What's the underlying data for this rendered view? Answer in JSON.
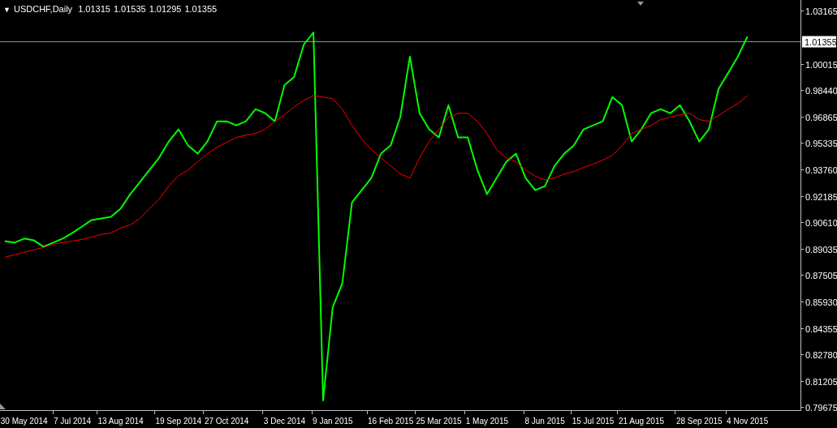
{
  "current_price": {
    "label": "1.01355"
  },
  "header": {
    "menu_glyph": "▼",
    "title": "USDCHF,Daily",
    "ohlc": [
      "1.01315",
      "1.01535",
      "1.01295",
      "1.01355"
    ]
  },
  "chart_data": {
    "type": "line",
    "categories": [
      null,
      null,
      "30 May 2014",
      null,
      null,
      null,
      null,
      "7 Jul 2014",
      null,
      null,
      null,
      null,
      "13 Aug 2014",
      null,
      null,
      null,
      null,
      null,
      "19 Sep 2014",
      null,
      null,
      null,
      null,
      "27 Oct 2014",
      null,
      null,
      null,
      null,
      null,
      "3 Dec 2014",
      null,
      null,
      null,
      null,
      "9 Jan 2015",
      null,
      null,
      null,
      null,
      null,
      "16 Feb 2015",
      null,
      null,
      null,
      null,
      "25 Mar 2015",
      null,
      null,
      null,
      null,
      "1 May 2015",
      null,
      null,
      null,
      null,
      null,
      "8 Jun 2015",
      null,
      null,
      null,
      null,
      "15 Jul 2015",
      null,
      null,
      null,
      null,
      "21 Aug 2015",
      null,
      null,
      null,
      null,
      null,
      "28 Sep 2015",
      null,
      null,
      null,
      null,
      "4 Nov 2015",
      null,
      null,
      null,
      null,
      null
    ],
    "series": [
      {
        "color": "#00ff00",
        "values": [
          0.895,
          0.8941,
          0.8965,
          0.8955,
          0.8917,
          0.8941,
          0.8965,
          0.8998,
          0.9036,
          0.9075,
          0.9084,
          0.9094,
          0.9142,
          0.9228,
          0.93,
          0.9372,
          0.9444,
          0.954,
          0.9612,
          0.9516,
          0.9468,
          0.954,
          0.966,
          0.966,
          0.9636,
          0.966,
          0.9732,
          0.9708,
          0.966,
          0.9875,
          0.9923,
          1.0115,
          1.0187,
          0.8006,
          0.8557,
          0.8701,
          0.918,
          0.9252,
          0.9324,
          0.9468,
          0.9516,
          0.9684,
          1.0043,
          0.9708,
          0.9612,
          0.9564,
          0.9756,
          0.9564,
          0.9564,
          0.9372,
          0.9228,
          0.9324,
          0.942,
          0.9468,
          0.9324,
          0.9252,
          0.9276,
          0.9396,
          0.9468,
          0.9516,
          0.9612,
          0.9636,
          0.966,
          0.9804,
          0.9756,
          0.954,
          0.9612,
          0.9708,
          0.9732,
          0.9708,
          0.9756,
          0.966,
          0.954,
          0.9612,
          0.9851,
          0.9947,
          1.0043,
          1.0163,
          null,
          null,
          null,
          null,
          null
        ]
      },
      {
        "color": "#ff0000",
        "values": [
          0.8854,
          0.8869,
          0.8883,
          0.8898,
          0.8912,
          0.8932,
          0.8941,
          0.895,
          0.896,
          0.8974,
          0.8989,
          0.8998,
          0.9027,
          0.9046,
          0.9084,
          0.9142,
          0.9199,
          0.9276,
          0.9338,
          0.9372,
          0.942,
          0.9468,
          0.9506,
          0.9535,
          0.9564,
          0.9578,
          0.9588,
          0.9612,
          0.966,
          0.9698,
          0.9746,
          0.9784,
          0.9813,
          0.9804,
          0.9794,
          0.9732,
          0.9636,
          0.9554,
          0.9492,
          0.9444,
          0.9396,
          0.9348,
          0.9324,
          0.9444,
          0.954,
          0.9612,
          0.9684,
          0.9708,
          0.9708,
          0.966,
          0.9588,
          0.9492,
          0.9444,
          0.942,
          0.9372,
          0.9334,
          0.9314,
          0.9324,
          0.9348,
          0.9362,
          0.9386,
          0.9406,
          0.943,
          0.9458,
          0.9516,
          0.9588,
          0.9612,
          0.9636,
          0.967,
          0.9684,
          0.9698,
          0.9708,
          0.967,
          0.966,
          0.9694,
          0.9732,
          0.9765,
          0.9813,
          null,
          null,
          null,
          null,
          null
        ]
      }
    ],
    "ylim": [
      0.7948,
      1.0379
    ],
    "yticks": [
      {
        "value": 1.03165,
        "label": "1.03165"
      },
      {
        "value": 1.00015,
        "label": "1.00015"
      },
      {
        "value": 0.9844,
        "label": "0.98440"
      },
      {
        "value": 0.96865,
        "label": "0.96865"
      },
      {
        "value": 0.95335,
        "label": "0.95335"
      },
      {
        "value": 0.9376,
        "label": "0.93760"
      },
      {
        "value": 0.92185,
        "label": "0.92185"
      },
      {
        "value": 0.9061,
        "label": "0.90610"
      },
      {
        "value": 0.89035,
        "label": "0.89035"
      },
      {
        "value": 0.87505,
        "label": "0.87505"
      },
      {
        "value": 0.8593,
        "label": "0.85930"
      },
      {
        "value": 0.84355,
        "label": "0.84355"
      },
      {
        "value": 0.8278,
        "label": "0.82780"
      },
      {
        "value": 0.81205,
        "label": "0.81205"
      },
      {
        "value": 0.79675,
        "label": "0.79675"
      }
    ]
  }
}
